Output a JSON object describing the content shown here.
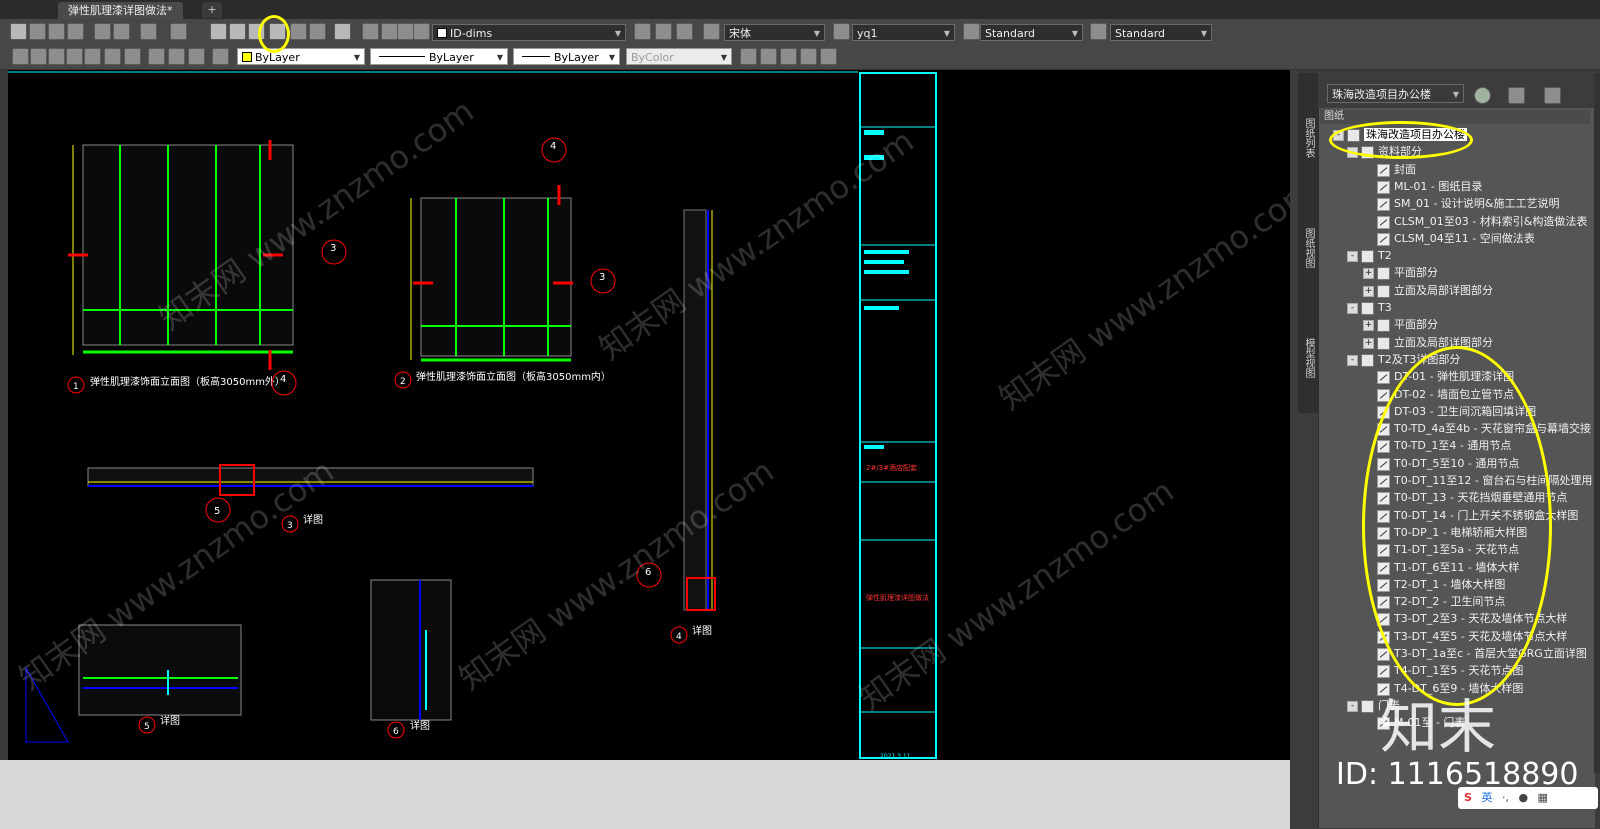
{
  "tabs": {
    "doc_title": "弹性肌理漆详图做法*",
    "add_label": "+"
  },
  "toolbar1": {
    "layer_combo": "ID-dims",
    "text_font": "宋体",
    "dimstyle": "yq1",
    "tablestyle": "Standard",
    "mleaderstyle": "Standard"
  },
  "toolbar2": {
    "color": "ByLayer",
    "linetype": "ByLayer",
    "lineweight": "ByLayer",
    "plotstyle": "ByColor"
  },
  "drawing": {
    "titles": [
      "弹性肌理漆饰面立面图（板高3050mm外）",
      "弹性肌理漆饰面立面图（板高3050mm内）"
    ],
    "detail_label": "详图",
    "detail_numbers": [
      "1",
      "2",
      "3",
      "4",
      "5",
      "6"
    ],
    "callouts": [
      "3",
      "3",
      "4",
      "4",
      "5",
      "6"
    ],
    "titleblock_project": "2#/3#酒店配套",
    "titleblock_drawing": "弹性肌理漆详图做法",
    "titleblock_date": "2021.3.11",
    "watermark": "知末网 www.znzmo.com"
  },
  "palette": {
    "project_combo": "珠海改造项目办公楼",
    "header": "图纸",
    "side_tabs": [
      "图纸列表",
      "图纸视图",
      "模型视图"
    ],
    "tree": [
      {
        "label": "珠海改造项目办公楼",
        "level": 0,
        "type": "root",
        "exp": "-"
      },
      {
        "label": "资料部分",
        "level": 1,
        "type": "folder",
        "exp": "-"
      },
      {
        "label": "封面",
        "level": 2,
        "type": "sheet"
      },
      {
        "label": "ML-01 - 图纸目录",
        "level": 2,
        "type": "sheet"
      },
      {
        "label": "SM_01 - 设计说明&施工工艺说明",
        "level": 2,
        "type": "sheet"
      },
      {
        "label": "CLSM_01至03 - 材料索引&构造做法表",
        "level": 2,
        "type": "sheet"
      },
      {
        "label": "CLSM_04至11 - 空间做法表",
        "level": 2,
        "type": "sheet"
      },
      {
        "label": "T2",
        "level": 1,
        "type": "folder",
        "exp": "-"
      },
      {
        "label": "平面部分",
        "level": 2,
        "type": "folder",
        "exp": "+"
      },
      {
        "label": "立面及局部详图部分",
        "level": 2,
        "type": "folder",
        "exp": "+"
      },
      {
        "label": "T3",
        "level": 1,
        "type": "folder",
        "exp": "-"
      },
      {
        "label": "平面部分",
        "level": 2,
        "type": "folder",
        "exp": "+"
      },
      {
        "label": "立面及局部详图部分",
        "level": 2,
        "type": "folder",
        "exp": "+"
      },
      {
        "label": "T2及T3详图部分",
        "level": 1,
        "type": "folder",
        "exp": "-"
      },
      {
        "label": "DT-01 - 弹性肌理漆详图",
        "level": 2,
        "type": "sheet"
      },
      {
        "label": "DT-02 - 墙面包立管节点",
        "level": 2,
        "type": "sheet"
      },
      {
        "label": "DT-03 - 卫生间沉箱回填详图",
        "level": 2,
        "type": "sheet"
      },
      {
        "label": "T0-TD_4a至4b - 天花窗帘盒与幕墙交接",
        "level": 2,
        "type": "sheet"
      },
      {
        "label": "T0-TD_1至4 - 通用节点",
        "level": 2,
        "type": "sheet"
      },
      {
        "label": "T0-DT_5至10 - 通用节点",
        "level": 2,
        "type": "sheet"
      },
      {
        "label": "T0-DT_11至12 - 窗台石与柱间隔处理用",
        "level": 2,
        "type": "sheet"
      },
      {
        "label": "T0-DT_13 - 天花挡烟垂壁通用节点",
        "level": 2,
        "type": "sheet"
      },
      {
        "label": "T0-DT_14 - 门上开关不锈钢盒大样图",
        "level": 2,
        "type": "sheet"
      },
      {
        "label": "T0-DP_1 - 电梯轿厢大样图",
        "level": 2,
        "type": "sheet"
      },
      {
        "label": "T1-DT_1至5a - 天花节点",
        "level": 2,
        "type": "sheet"
      },
      {
        "label": "T1-DT_6至11 - 墙体大样",
        "level": 2,
        "type": "sheet"
      },
      {
        "label": "T2-DT_1 - 墙体大样图",
        "level": 2,
        "type": "sheet"
      },
      {
        "label": "T2-DT_2 - 卫生间节点",
        "level": 2,
        "type": "sheet"
      },
      {
        "label": "T3-DT_2至3 - 天花及墙体节点大样",
        "level": 2,
        "type": "sheet"
      },
      {
        "label": "T3-DT_4至5 - 天花及墙体节点大样",
        "level": 2,
        "type": "sheet"
      },
      {
        "label": "T3-DT_1a至c - 首层大堂GRG立面详图",
        "level": 2,
        "type": "sheet"
      },
      {
        "label": "T4-DT_1至5 - 天花节点图",
        "level": 2,
        "type": "sheet"
      },
      {
        "label": "T4-DT_6至9 - 墙体大样图",
        "level": 2,
        "type": "sheet"
      },
      {
        "label": "门表",
        "level": 1,
        "type": "folder",
        "exp": "-"
      },
      {
        "label": "M-01至 - 门表",
        "level": 2,
        "type": "sheet"
      }
    ]
  },
  "overlay": {
    "id_text": "ID: 1116518890",
    "logo_text": "知末",
    "ime_text": "英"
  },
  "colors": {
    "highlight": "#ffff00",
    "cad_green": "#00ff00",
    "cad_red": "#ff0000",
    "cad_cyan": "#00ffff",
    "cad_blue": "#0000ff"
  }
}
